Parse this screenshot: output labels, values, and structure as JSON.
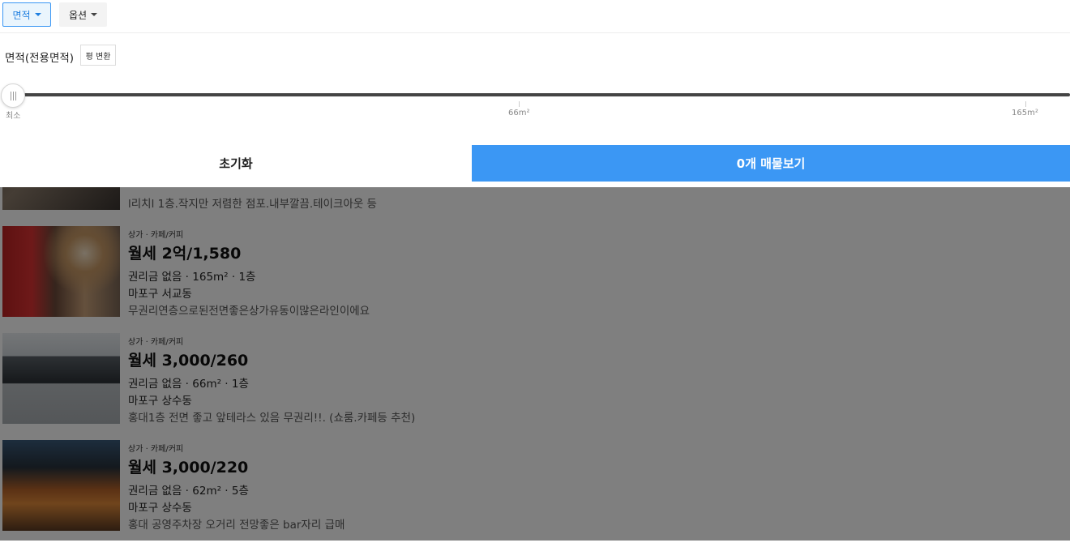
{
  "tabs": [
    {
      "label": "면적",
      "active": true
    },
    {
      "label": "옵션",
      "active": false
    }
  ],
  "area_filter": {
    "label": "면적(전용면적)",
    "pyeong_button": "평 변환",
    "slider_min_label": "최소",
    "ticks": [
      "66m²",
      "165m²"
    ]
  },
  "actions": {
    "reset": "초기화",
    "view": "0개 매물보기",
    "accent_color": "#3b97f4"
  },
  "listings": [
    {
      "category": "",
      "price": "",
      "spec": "",
      "location": "",
      "description": "l리치l 1층.작지만 저렴한 점포.내부깔끔.테이크아웃 등"
    },
    {
      "category": "상가 · 카페/커피",
      "price": "월세 2억/1,580",
      "spec": "권리금 없음 · 165m² · 1층",
      "location": "마포구 서교동",
      "description": "무권리연층으로된전면좋은상가유동이많은라인이에요"
    },
    {
      "category": "상가 · 카페/커피",
      "price": "월세 3,000/260",
      "spec": "권리금 없음 · 66m² · 1층",
      "location": "마포구 상수동",
      "description": "홍대1층 전면 좋고 앞테라스 있음 무권리!!. (쇼룸.카페등 추천)"
    },
    {
      "category": "상가 · 카페/커피",
      "price": "월세 3,000/220",
      "spec": "권리금 없음 · 62m² · 5층",
      "location": "마포구 상수동",
      "description": "홍대 공영주차장 오거리 전망좋은 bar자리 급매"
    }
  ]
}
